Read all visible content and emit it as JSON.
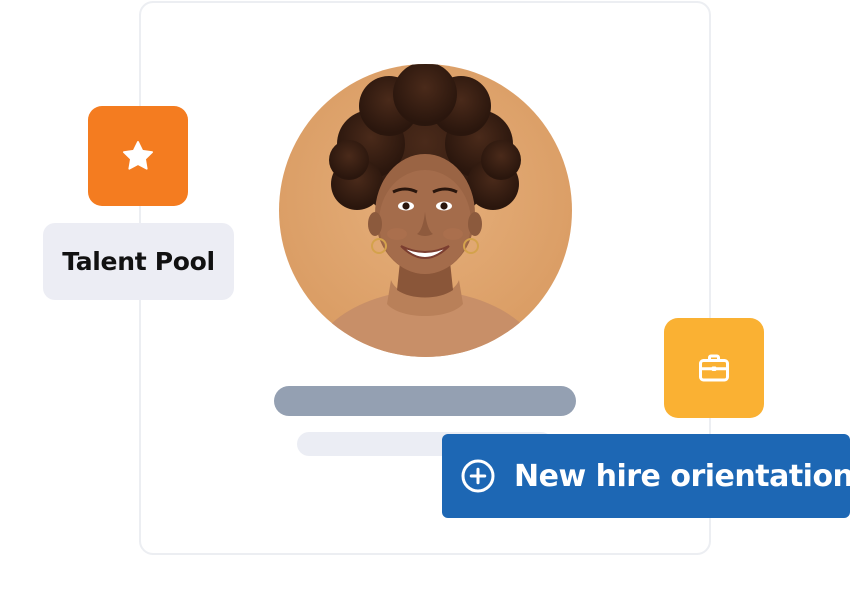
{
  "talent_pool": {
    "label": "Talent Pool",
    "icon": "star-icon",
    "color": "#f47c20"
  },
  "briefcase_tile": {
    "icon": "briefcase-icon",
    "color": "#fab133"
  },
  "profile_card": {
    "avatar": "person-photo",
    "name_placeholder_color": "#94a0b2",
    "subtitle_placeholder_color": "#ebedf4"
  },
  "cta": {
    "label": "New hire orientation",
    "icon": "plus-circle-icon",
    "color": "#1d67b4"
  }
}
